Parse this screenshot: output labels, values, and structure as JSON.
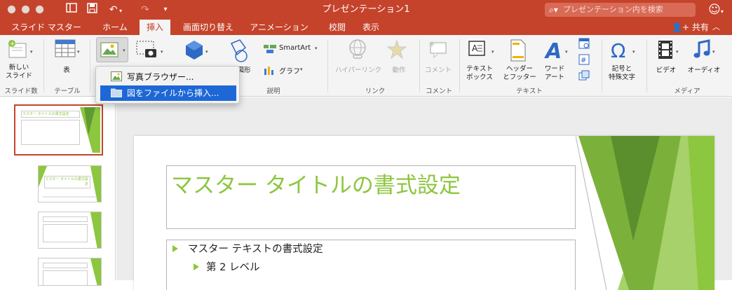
{
  "window": {
    "title": "プレゼンテーション1",
    "search_placeholder": "プレゼンテーション内を検索"
  },
  "tabs": [
    {
      "label": "スライド マスター"
    },
    {
      "label": "ホーム"
    },
    {
      "label": "挿入",
      "active": true
    },
    {
      "label": "画面切り替え"
    },
    {
      "label": "アニメーション"
    },
    {
      "label": "校閲"
    },
    {
      "label": "表示"
    }
  ],
  "share_label": "共有",
  "ribbon": {
    "new_slide": "新しい\nスライド",
    "table": "表",
    "shapes": "図形",
    "smartart": "SmartArt",
    "chart": "グラフ",
    "hyperlink": "ハイパーリンク",
    "action": "動作",
    "comment": "コメント",
    "textbox": "テキスト\nボックス",
    "header_footer": "ヘッダー\nとフッター",
    "wordart": "ワード\nアート",
    "symbol": "記号と\n特殊文字",
    "video": "ビデオ",
    "audio": "オーディオ",
    "groups": {
      "slides": "スライド数",
      "table": "テーブル",
      "illustrations": "説明",
      "links": "リンク",
      "comments": "コメント",
      "text": "テキスト",
      "media": "メディア"
    }
  },
  "picture_menu": {
    "items": [
      {
        "label": "写真ブラウザー..."
      },
      {
        "label": "図をファイルから挿入...",
        "selected": true
      }
    ]
  },
  "slide": {
    "title": "マスター タイトルの書式設定",
    "level1": "マスター テキストの書式設定",
    "level2": "第 2 レベル"
  },
  "thumb": {
    "main_title": "マスター タイトルの書式設定",
    "layout_title": "マスター タイトルの書式設定"
  },
  "colors": {
    "accent": "#c5432b",
    "title_green": "#8dc63f",
    "menu_highlight": "#1d67d6"
  }
}
